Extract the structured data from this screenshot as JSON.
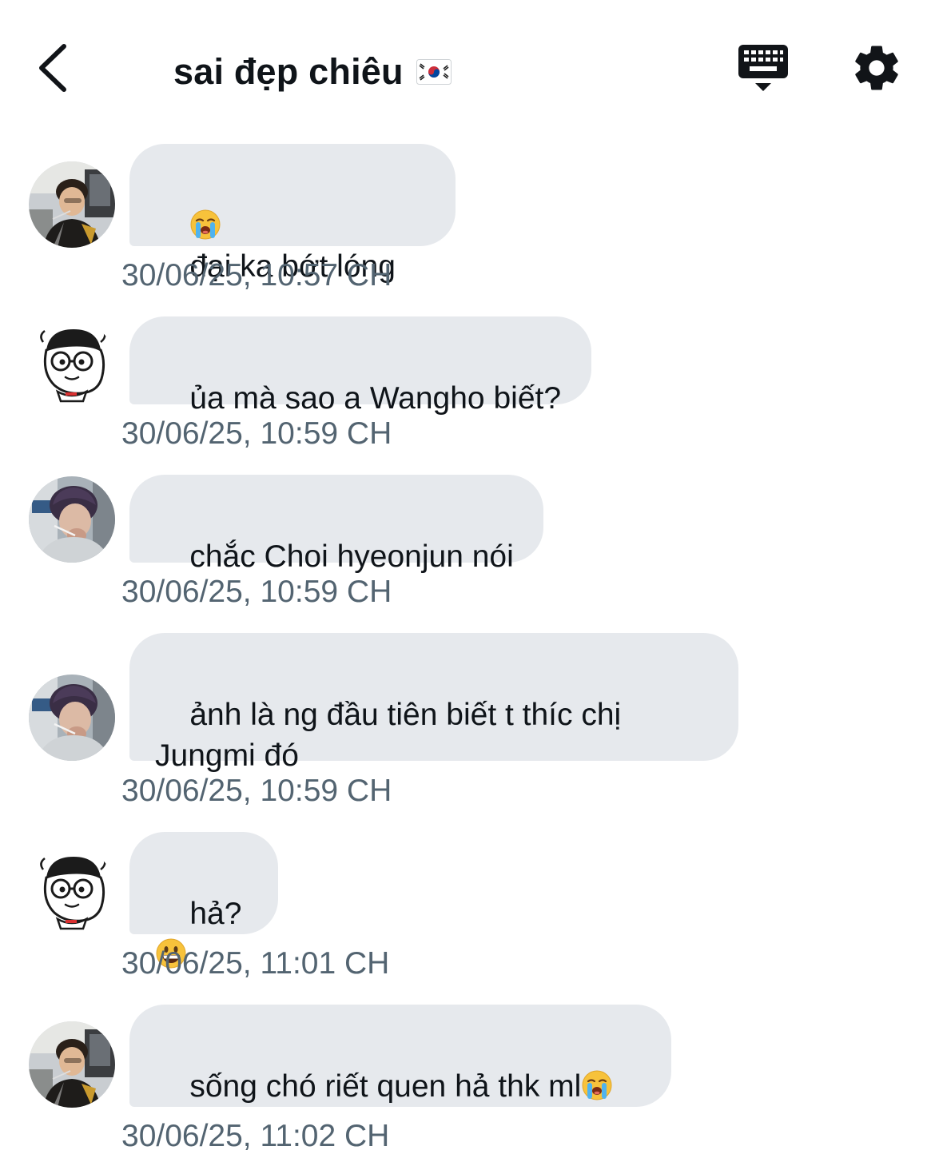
{
  "header": {
    "back_icon": "chevron-left-icon",
    "title": "sai đẹp chiêu",
    "flag_icon": "flag-south-korea-icon",
    "keyboard_icon": "keyboard-icon",
    "settings_icon": "gear-icon"
  },
  "colors": {
    "bubble_bg": "#e6e9ed",
    "timestamp": "#536471",
    "text": "#0f1419"
  },
  "messages": [
    {
      "sender_avatar": "avatar-photo-a",
      "emoji_before": "loudly-crying-face-icon",
      "text": "đại ka bớt lóng",
      "timestamp": "30/06/25, 10:57 CH"
    },
    {
      "sender_avatar": "avatar-cartoon",
      "text": "ủa mà sao a Wangho biết?",
      "timestamp": "30/06/25, 10:59 CH"
    },
    {
      "sender_avatar": "avatar-photo-b",
      "text": "chắc Choi hyeonjun nói",
      "timestamp": "30/06/25, 10:59 CH"
    },
    {
      "sender_avatar": "avatar-photo-b",
      "text": "ảnh là ng đầu tiên biết t thíc chị\nJungmi đó",
      "timestamp": "30/06/25, 10:59 CH"
    },
    {
      "sender_avatar": "avatar-cartoon",
      "text": "hả?",
      "emoji_after": "grinning-face-icon",
      "timestamp": "30/06/25, 11:01 CH"
    },
    {
      "sender_avatar": "avatar-photo-a",
      "text": "sống chó riết quen hả thk ml",
      "emoji_after": "loudly-crying-face-icon",
      "timestamp": "30/06/25, 11:02 CH"
    }
  ]
}
